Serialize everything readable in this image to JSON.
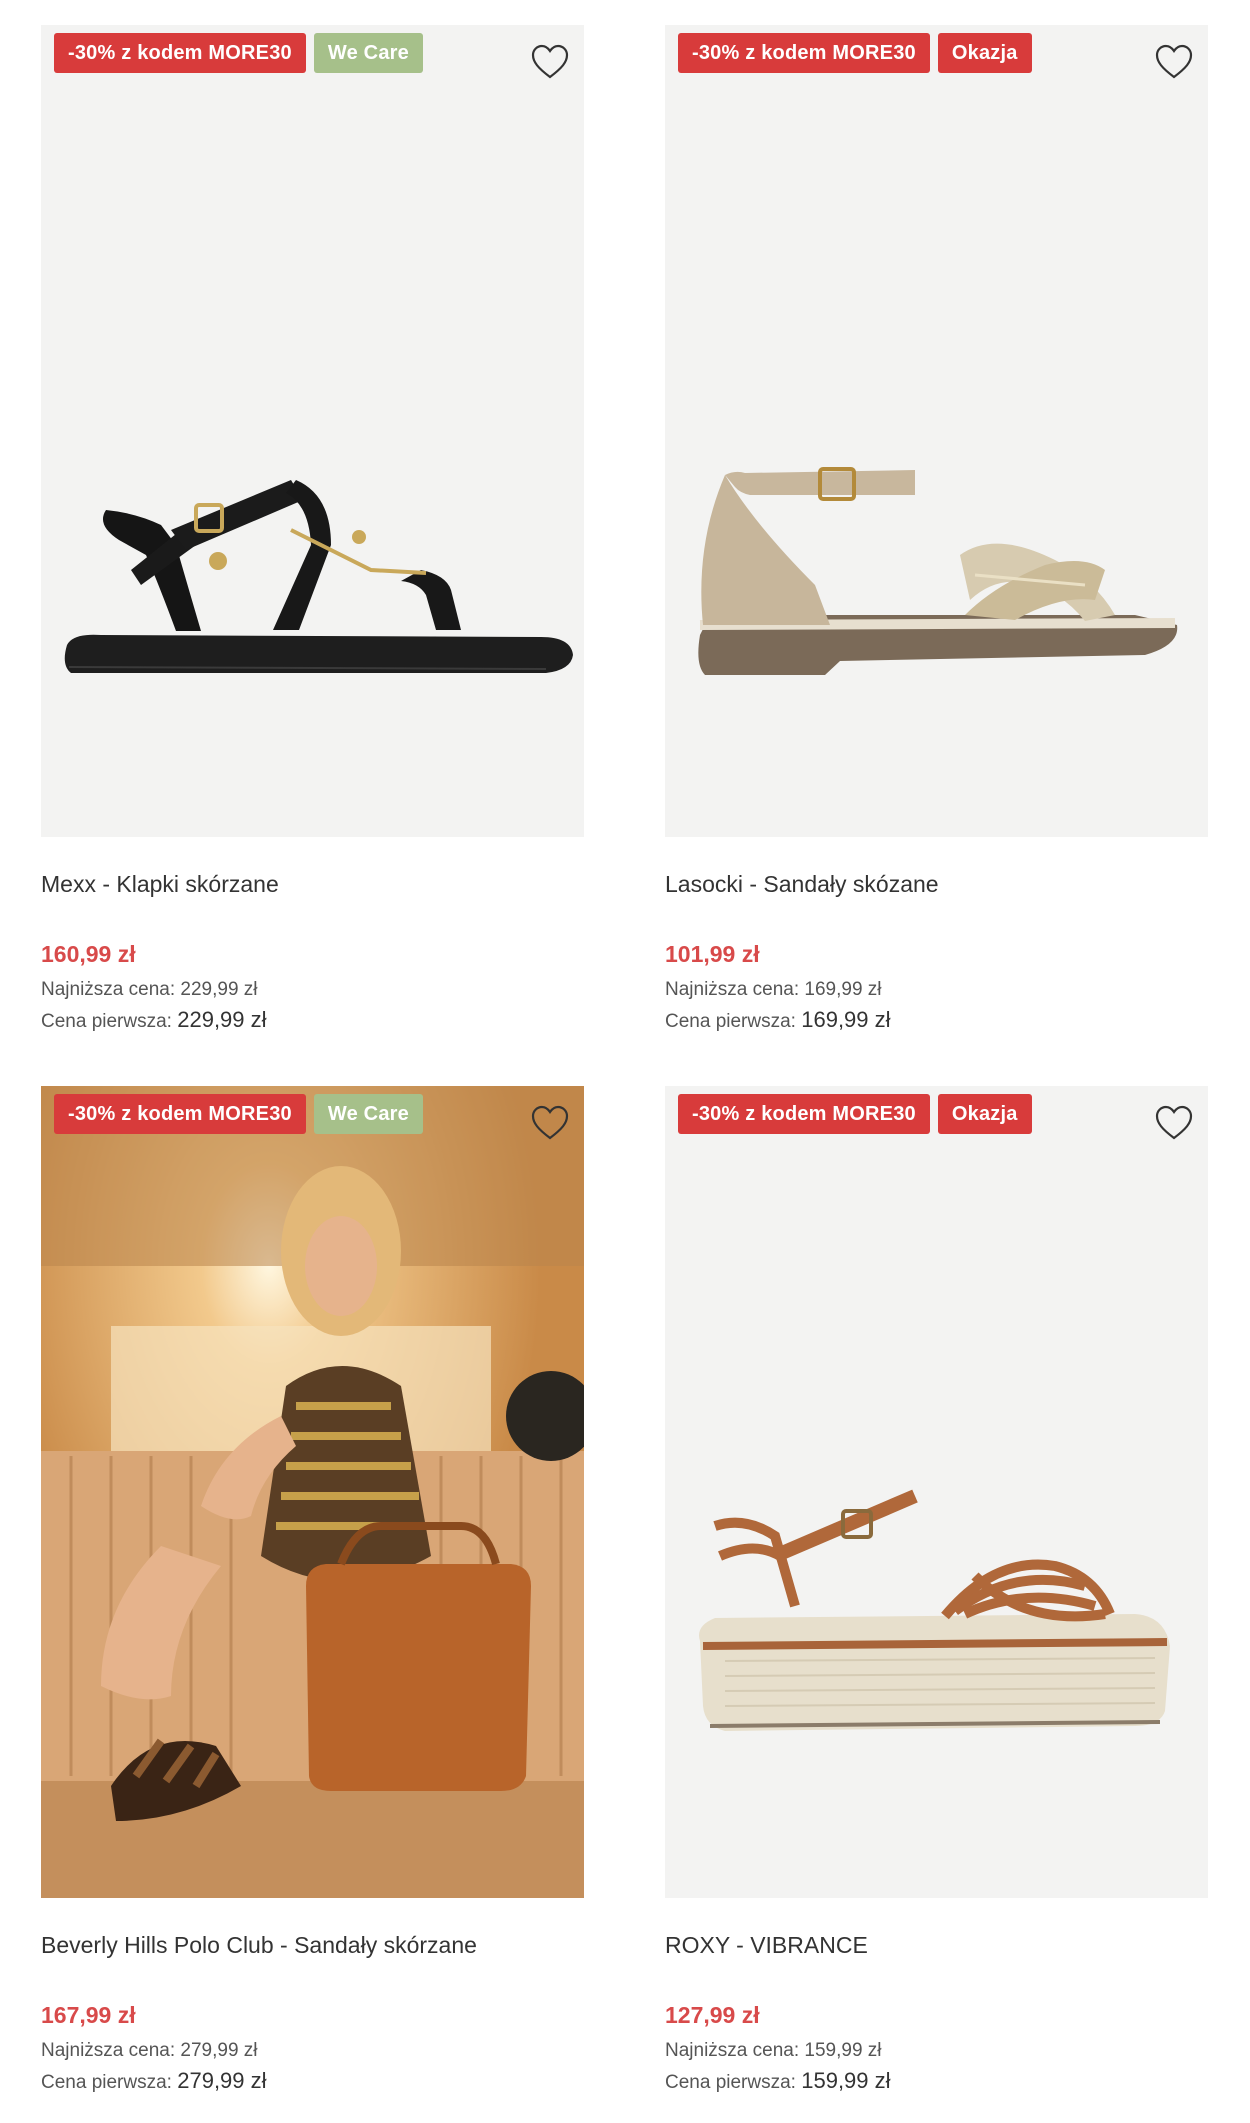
{
  "products": [
    {
      "badges": [
        "-30% z kodem MORE30",
        "We Care"
      ],
      "name": "Mexx - Klapki skórzane",
      "price": "160,99 zł",
      "lowest_label": "Najniższa cena:",
      "lowest_value": "229,99 zł",
      "first_label": "Cena pierwsza:",
      "first_value": "229,99 zł",
      "image": "black leather sandal"
    },
    {
      "badges": [
        "-30% z kodem MORE30",
        "Okazja"
      ],
      "name": "Lasocki - Sandały skózane",
      "price": "101,99 zł",
      "lowest_label": "Najniższa cena:",
      "lowest_value": "169,99 zł",
      "first_label": "Cena pierwsza:",
      "first_value": "169,99 zł",
      "image": "beige and gold metallic sandal"
    },
    {
      "badges": [
        "-30% z kodem MORE30",
        "We Care"
      ],
      "name": "Beverly Hills Polo Club - Sandały skórzane",
      "price": "167,99 zł",
      "lowest_label": "Najniższa cena:",
      "lowest_value": "279,99 zł",
      "first_label": "Cena pierwsza:",
      "first_value": "279,99 zł",
      "image": "model in car with brown sandals and bag"
    },
    {
      "badges": [
        "-30% z kodem MORE30",
        "Okazja"
      ],
      "name": "ROXY - VIBRANCE",
      "price": "127,99 zł",
      "lowest_label": "Najniższa cena:",
      "lowest_value": "159,99 zł",
      "first_label": "Cena pierwsza:",
      "first_value": "159,99 zł",
      "image": "platform sandal with tan woven straps"
    }
  ],
  "icons": {
    "wishlist": "heart-outline-icon"
  },
  "colors": {
    "promo_badge": "#d83b3b",
    "okazja_badge": "#d83b3b",
    "wecare_badge": "#a6c08a",
    "price": "#d84a4a",
    "image_background": "#f3f3f2"
  }
}
